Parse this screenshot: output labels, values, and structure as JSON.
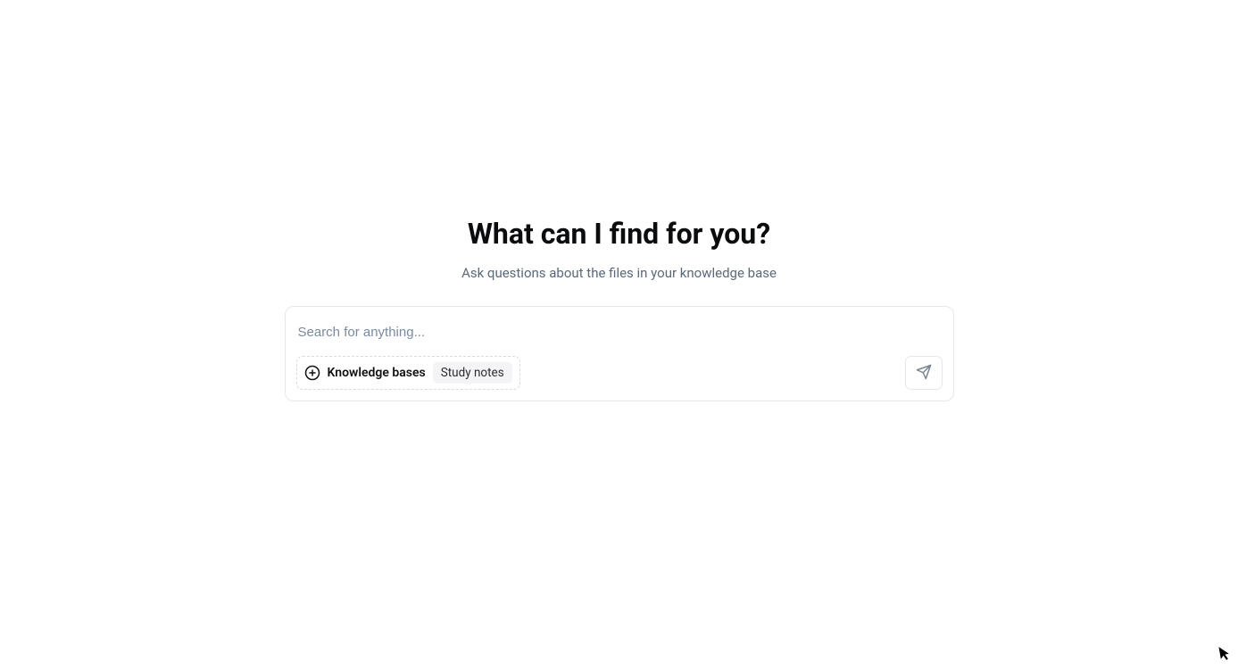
{
  "main": {
    "heading": "What can I find for you?",
    "subheading": "Ask questions about the files in your knowledge base"
  },
  "search": {
    "placeholder": "Search for anything...",
    "value": "",
    "knowledge_bases_label": "Knowledge bases",
    "selected_base": "Study notes"
  }
}
